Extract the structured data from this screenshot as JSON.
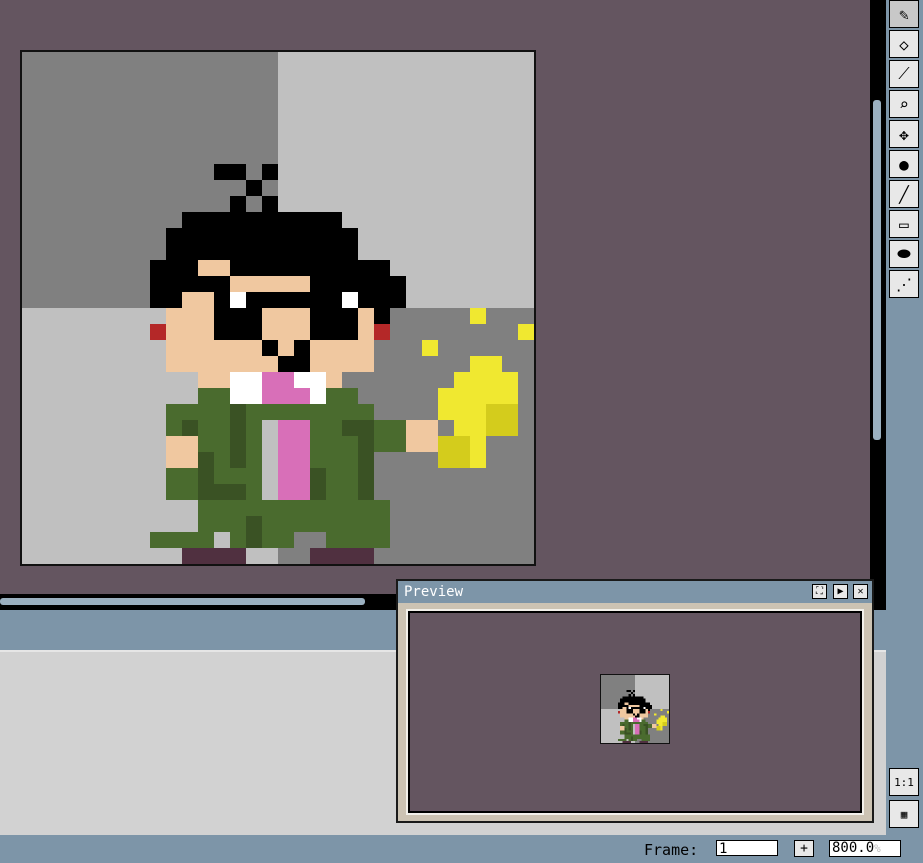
{
  "colors": {
    "workspace": "#645560",
    "chrome": "#7d95a8",
    "checker_dark": "#808080",
    "checker_light": "#c0c0c0",
    "suit": "#4a6b2e",
    "suit_shadow": "#3a5224",
    "skin": "#f0c8a0",
    "hair": "#000000",
    "tie": "#d86fb8",
    "collar": "#ffffff",
    "cheek": "#b42828",
    "spark": "#f0e830",
    "spark_shadow": "#d4cc1c",
    "shoe": "#503040"
  },
  "tools": [
    {
      "name": "pencil-icon",
      "glyph": "✎"
    },
    {
      "name": "eraser-icon",
      "glyph": "◇"
    },
    {
      "name": "eyedropper-icon",
      "glyph": "⟋"
    },
    {
      "name": "zoom-icon",
      "glyph": "⌕"
    },
    {
      "name": "move-icon",
      "glyph": "✥"
    },
    {
      "name": "fill-icon",
      "glyph": "●"
    },
    {
      "name": "line-icon",
      "glyph": "╱"
    },
    {
      "name": "rectangle-icon",
      "glyph": "▭"
    },
    {
      "name": "ellipse-icon",
      "glyph": "⬬"
    },
    {
      "name": "airbrush-icon",
      "glyph": "⋰"
    }
  ],
  "preview": {
    "title": "Preview",
    "buttons": [
      "⛶",
      "▶",
      "✕"
    ]
  },
  "view_buttons": {
    "actual_size": "1:1",
    "filmstrip": "▦"
  },
  "status": {
    "frame_label": "Frame:",
    "frame_value": "1",
    "add_button": "+",
    "zoom_value": "800.0",
    "zoom_unit": "%"
  }
}
